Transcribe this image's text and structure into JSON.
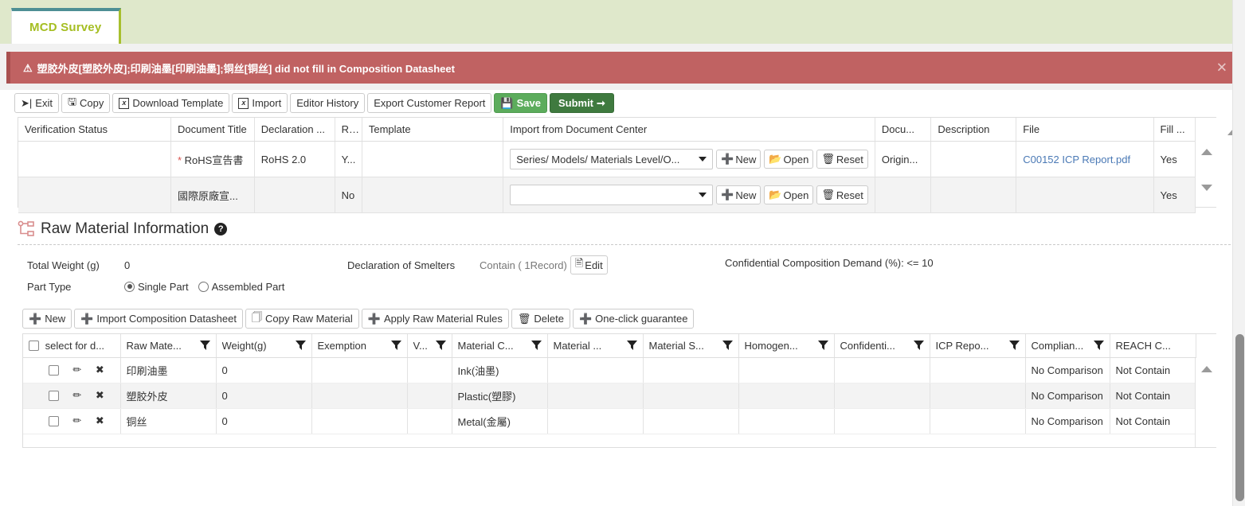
{
  "tab": {
    "label": "MCD Survey"
  },
  "alert": {
    "icon": "warning-icon",
    "message": "塑胶外皮[塑胶外皮];印刷油墨[印刷油墨];铜丝[铜丝] did not fill in Composition Datasheet",
    "close_label": "✕",
    "bg_color": "#c06262"
  },
  "toolbar": {
    "buttons": [
      {
        "name": "exit-button",
        "label": "Exit",
        "icon": "exit-icon",
        "style": "default"
      },
      {
        "name": "copy-button",
        "label": "Copy",
        "icon": "copy-icon",
        "style": "default"
      },
      {
        "name": "download-template-button",
        "label": "Download Template",
        "icon": "excel-icon",
        "style": "default"
      },
      {
        "name": "import-button",
        "label": "Import",
        "icon": "excel-icon",
        "style": "default"
      },
      {
        "name": "editor-history-button",
        "label": "Editor History",
        "icon": "",
        "style": "default"
      },
      {
        "name": "export-customer-report-button",
        "label": "Export Customer Report",
        "icon": "",
        "style": "default"
      },
      {
        "name": "save-button",
        "label": "Save",
        "icon": "save-icon",
        "style": "save"
      },
      {
        "name": "submit-button",
        "label": "Submit",
        "icon": "arrow-right-icon",
        "style": "submit"
      }
    ],
    "save_color": "#5cac5c",
    "submit_color": "#3f7a3f"
  },
  "document_grid": {
    "columns": [
      "Verification Status",
      "Document Title",
      "Declaration ...",
      "R...",
      "Template",
      "Import from Document Center",
      "Docu...",
      "Description",
      "File",
      "Fill ..."
    ],
    "rows": [
      {
        "verification_status": "",
        "document_title": "RoHS宣告書",
        "required_star": "*",
        "declaration": "RoHS 2.0",
        "r": "Y...",
        "template": "",
        "import_value": "Series/ Models/ Materials Level/O...",
        "new_label": "New",
        "open_label": "Open",
        "reset_label": "Reset",
        "document": "Origin...",
        "description": "",
        "file": "C00152 ICP Report.pdf",
        "fill": "Yes"
      },
      {
        "verification_status": "",
        "document_title": "國際原廠宣...",
        "required_star": "",
        "declaration": "",
        "r": "No",
        "template": "",
        "import_value": "",
        "new_label": "New",
        "open_label": "Open",
        "reset_label": "Reset",
        "document": "",
        "description": "",
        "file": "",
        "fill": "Yes"
      }
    ]
  },
  "raw_material_section": {
    "title": "Raw Material Information",
    "help_icon": "question-mark-icon",
    "tree_icon": "hierarchy-icon",
    "total_weight_label": "Total Weight (g)",
    "total_weight_value": "0",
    "smelters_label": "Declaration of Smelters",
    "smelters_value": "Contain ( 1Record)",
    "smelters_edit_label": "Edit",
    "confidential_demand": "Confidential Composition Demand (%): <= 10",
    "part_type_label": "Part Type",
    "part_type_options": [
      {
        "label": "Single Part",
        "checked": true
      },
      {
        "label": "Assembled Part",
        "checked": false
      }
    ]
  },
  "raw_material_toolbar": {
    "buttons": [
      {
        "name": "new-button",
        "label": "New",
        "icon": "plus-icon"
      },
      {
        "name": "import-composition-datasheet-button",
        "label": "Import Composition Datasheet",
        "icon": "plus-icon"
      },
      {
        "name": "copy-raw-material-button",
        "label": "Copy Raw Material",
        "icon": "copy-icon"
      },
      {
        "name": "apply-raw-material-rules-button",
        "label": "Apply Raw Material Rules",
        "icon": "plus-icon"
      },
      {
        "name": "delete-button",
        "label": "Delete",
        "icon": "trash-icon"
      },
      {
        "name": "one-click-guarantee-button",
        "label": "One-click guarantee",
        "icon": "plus-icon"
      }
    ]
  },
  "raw_material_grid": {
    "select_label": "select for d...",
    "columns": [
      {
        "label": "Raw Mate...",
        "filter": true
      },
      {
        "label": "Weight(g)",
        "filter": true
      },
      {
        "label": "Exemption",
        "filter": true
      },
      {
        "label": "V...",
        "filter": true
      },
      {
        "label": "Material C...",
        "filter": true
      },
      {
        "label": "Material ...",
        "filter": true
      },
      {
        "label": "Material S...",
        "filter": true
      },
      {
        "label": "Homogen...",
        "filter": true
      },
      {
        "label": "Confidenti...",
        "filter": true
      },
      {
        "label": "ICP Repo...",
        "filter": true
      },
      {
        "label": "Complian...",
        "filter": true
      },
      {
        "label": "REACH C...",
        "filter": false
      }
    ],
    "rows": [
      {
        "checked": false,
        "raw_material": "印刷油墨",
        "weight": "0",
        "exemption": "",
        "v": "",
        "material_c": "Ink(油墨)",
        "material": "",
        "material_s": "",
        "homogen": "",
        "confidential": "",
        "icp_report": "",
        "compliance": "No Comparison",
        "reach": "Not Contain"
      },
      {
        "checked": false,
        "raw_material": "塑胶外皮",
        "weight": "0",
        "exemption": "",
        "v": "",
        "material_c": "Plastic(塑膠)",
        "material": "",
        "material_s": "",
        "homogen": "",
        "confidential": "",
        "icp_report": "",
        "compliance": "No Comparison",
        "reach": "Not Contain"
      },
      {
        "checked": false,
        "raw_material": "铜丝",
        "weight": "0",
        "exemption": "",
        "v": "",
        "material_c": "Metal(金屬)",
        "material": "",
        "material_s": "",
        "homogen": "",
        "confidential": "",
        "icp_report": "",
        "compliance": "No Comparison",
        "reach": "Not Contain"
      }
    ]
  }
}
